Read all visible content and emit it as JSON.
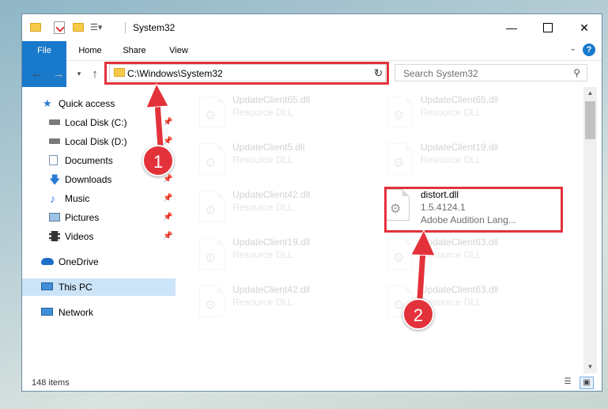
{
  "window": {
    "title": "System32"
  },
  "ribbon": {
    "tabs": [
      {
        "label": "File"
      },
      {
        "label": "Home"
      },
      {
        "label": "Share"
      },
      {
        "label": "View"
      }
    ],
    "help": "?"
  },
  "address": {
    "path": "C:\\Windows\\System32"
  },
  "search": {
    "placeholder": "Search System32"
  },
  "sidebar": {
    "items": [
      {
        "label": "Quick access"
      },
      {
        "label": "Local Disk (C:)"
      },
      {
        "label": "Local Disk (D:)"
      },
      {
        "label": "Documents"
      },
      {
        "label": "Downloads"
      },
      {
        "label": "Music"
      },
      {
        "label": "Pictures"
      },
      {
        "label": "Videos"
      },
      {
        "label": "OneDrive"
      },
      {
        "label": "This PC"
      },
      {
        "label": "Network"
      }
    ]
  },
  "files": {
    "left": [
      {
        "name": "UpdateClient65.dll",
        "type": "Resource DLL"
      },
      {
        "name": "UpdateClient5.dll",
        "type": "Resource DLL"
      },
      {
        "name": "UpdateClient42.dll",
        "type": "Resource DLL"
      },
      {
        "name": "UpdateClient19.dll",
        "type": "Resource DLL"
      },
      {
        "name": "UpdateClient42.dll",
        "type": "Resource DLL"
      }
    ],
    "right": [
      {
        "name": "UpdateClient65.dll",
        "type": "Resource DLL"
      },
      {
        "name": "UpdateClient19.dll",
        "type": "Resource DLL"
      },
      {
        "name": "UpdateClient63.dll",
        "type": "Resource DLL"
      },
      {
        "name": "UpdateClient63.dll",
        "type": "Resource DLL"
      }
    ],
    "highlighted": {
      "name": "distort.dll",
      "version": "1.5.4124.1",
      "description": "Adobe Audition Lang..."
    }
  },
  "status": {
    "count": "148 items"
  },
  "annotations": {
    "step1": "1",
    "step2": "2"
  },
  "colors": {
    "accent": "#1979ca",
    "highlight": "#e3323a"
  }
}
